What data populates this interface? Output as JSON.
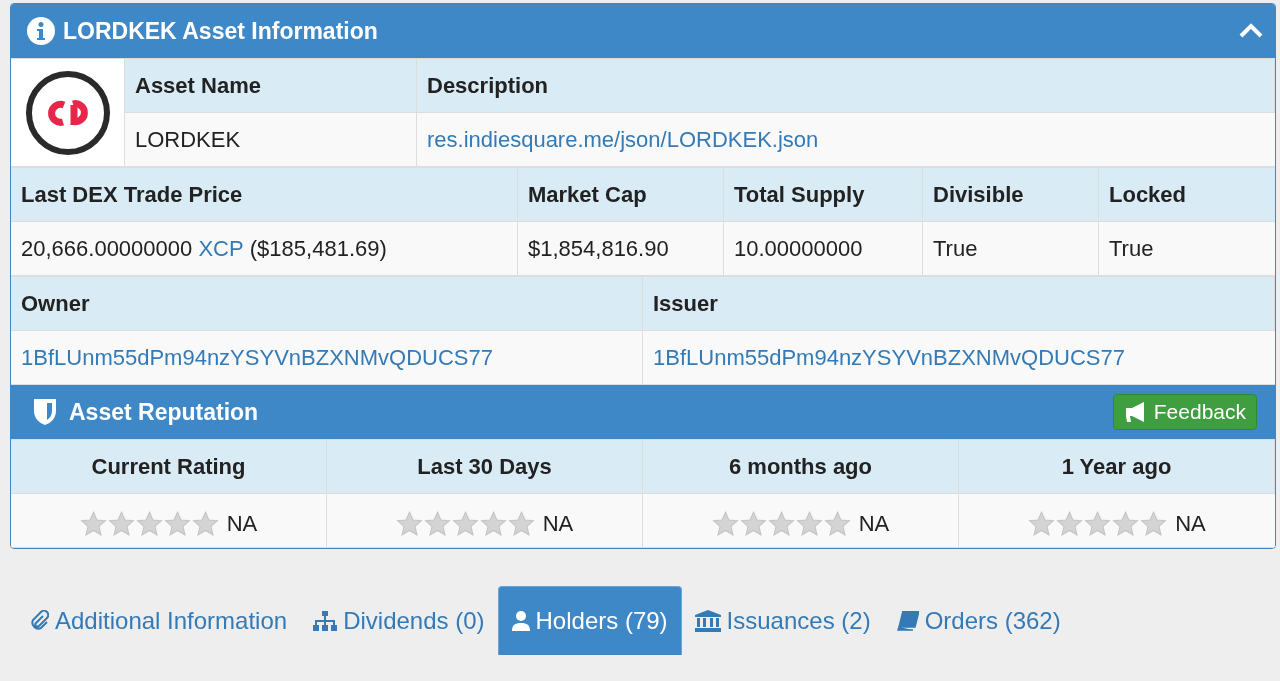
{
  "panel": {
    "title": "LORDKEK Asset Information"
  },
  "asset": {
    "headers": [
      "Asset Name",
      "Description"
    ],
    "name": "LORDKEK",
    "description": "res.indiesquare.me/json/LORDKEK.json"
  },
  "market": [
    {
      "label": "Last DEX Trade Price",
      "kind": "price",
      "amount": "20,666.00000000",
      "currency": "XCP",
      "usd": "($185,481.69)"
    },
    {
      "label": "Market Cap",
      "kind": "text",
      "value": "$1,854,816.90"
    },
    {
      "label": "Total Supply",
      "kind": "text",
      "value": "10.00000000"
    },
    {
      "label": "Divisible",
      "kind": "text",
      "value": "True"
    },
    {
      "label": "Locked",
      "kind": "text",
      "value": "True"
    }
  ],
  "parties": [
    {
      "label": "Owner",
      "address": "1BfLUnm55dPm94nzYSYVnBZXNMvQDUCS77"
    },
    {
      "label": "Issuer",
      "address": "1BfLUnm55dPm94nzYSYVnBZXNMvQDUCS77"
    }
  ],
  "reputation": {
    "title": "Asset Reputation",
    "button": "Feedback",
    "ratings": [
      {
        "label": "Current Rating",
        "stars": 0,
        "value": "NA"
      },
      {
        "label": "Last 30 Days",
        "stars": 0,
        "value": "NA"
      },
      {
        "label": "6 months ago",
        "stars": 0,
        "value": "NA"
      },
      {
        "label": "1 Year ago",
        "stars": 0,
        "value": "NA"
      }
    ]
  },
  "tabs": [
    {
      "label": "Additional Information",
      "selected": false
    },
    {
      "label": "Dividends (0)",
      "selected": false
    },
    {
      "label": "Holders (79)",
      "selected": true
    },
    {
      "label": "Issuances (2)",
      "selected": false
    },
    {
      "label": "Orders (362)",
      "selected": false
    }
  ]
}
